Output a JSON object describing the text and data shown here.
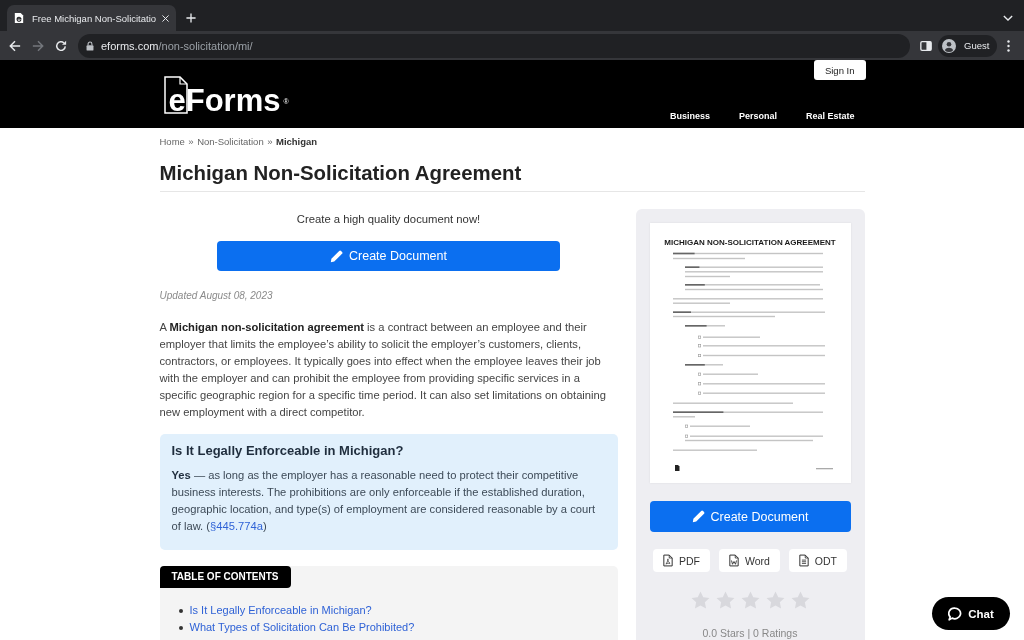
{
  "browser": {
    "tabs": [
      {
        "title": "Free Michigan Non-Solicitatio",
        "selected": true
      }
    ],
    "nav_buttons": [
      {
        "kind": "back",
        "disabled": false
      },
      {
        "kind": "forward",
        "disabled": true
      },
      {
        "kind": "reload",
        "disabled": false
      }
    ],
    "address": {
      "host": "eforms.com",
      "path": "/non-solicitation/mi/"
    },
    "profile": {
      "label": "Guest"
    }
  },
  "site_header": {
    "logo": {
      "text": "eForms",
      "mark": "®"
    },
    "sign_in": "Sign In",
    "nav": [
      "Business",
      "Personal",
      "Real Estate"
    ]
  },
  "breadcrumb": [
    {
      "kind": "link",
      "text": "Home"
    },
    {
      "kind": "separator",
      "text": "»"
    },
    {
      "kind": "link",
      "text": "Non-Solicitation"
    },
    {
      "kind": "separator",
      "text": "»"
    },
    {
      "kind": "current",
      "text": "Michigan"
    }
  ],
  "title": "Michigan Non-Solicitation Agreement",
  "main": {
    "tagline": "Create a high quality document now!",
    "create_button": "Create Document",
    "updated": "Updated August 08, 2023",
    "intro": "A **Michigan non-solicitation agreement** is a contract between an employee and their employer that limits the employee’s ability to solicit the employer’s customers, clients, contractors, or employees. It typically goes into effect when the employee leaves their job with the employer and can prohibit the employee from providing specific services in a specific geographic region for a specific time period. It can also set limitations on obtaining new employment with a direct competitor.",
    "callout": {
      "heading": "Is It Legally Enforceable in Michigan?",
      "text": "**Yes** — as long as the employer has a reasonable need to protect their competitive business interests. The prohibitions are only enforceable if the established duration, geographic location, and type(s) of employment are considered reasonable by a court of law. (",
      "link": "§445.774a",
      "text_after": ")"
    },
    "toc": {
      "label": "TABLE OF CONTENTS",
      "items": [
        "Is It Legally Enforceable in Michigan?",
        "What Types of Solicitation Can Be Prohibited?"
      ]
    }
  },
  "sidebar": {
    "document_preview": {
      "title": "MICHIGAN NON-SOLICITATION AGREEMENT"
    },
    "create_button": "Create Document",
    "formats": [
      {
        "kind": "pdf",
        "label": "PDF"
      },
      {
        "kind": "word",
        "label": "Word"
      },
      {
        "kind": "odt",
        "label": "ODT"
      }
    ],
    "rating": {
      "stars": 0,
      "text": "0.0 Stars | 0 Ratings"
    }
  },
  "chat": {
    "label": "Chat"
  }
}
